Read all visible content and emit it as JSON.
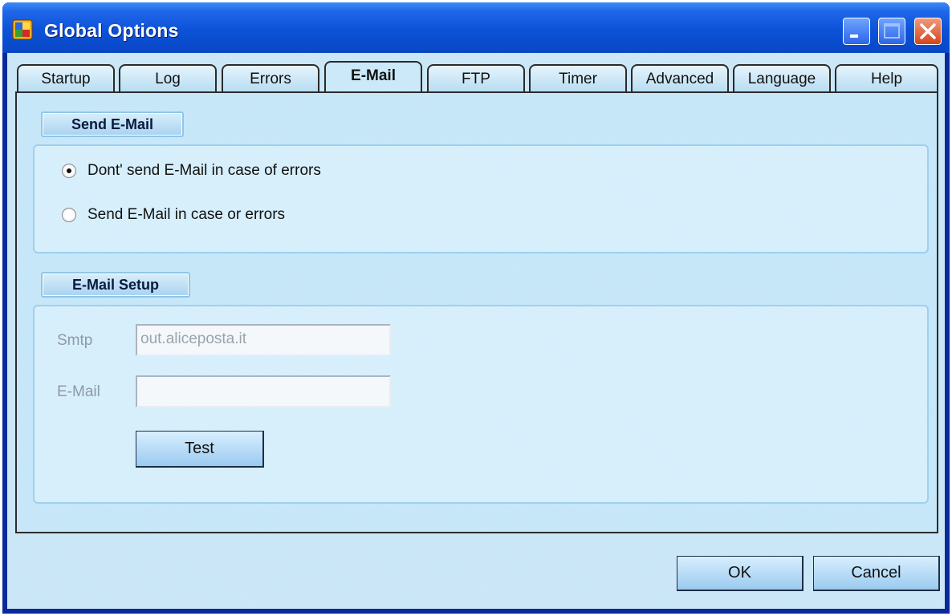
{
  "window": {
    "title": "Global Options"
  },
  "tabs": [
    {
      "label": "Startup"
    },
    {
      "label": "Log"
    },
    {
      "label": "Errors"
    },
    {
      "label": "E-Mail",
      "active": true
    },
    {
      "label": "FTP"
    },
    {
      "label": "Timer"
    },
    {
      "label": "Advanced"
    },
    {
      "label": "Language"
    },
    {
      "label": "Help"
    }
  ],
  "send_email": {
    "group_label": "Send E-Mail",
    "options": [
      {
        "label": "Dont' send E-Mail in case of errors",
        "selected": true
      },
      {
        "label": "Send E-Mail in case or errors",
        "selected": false
      }
    ]
  },
  "email_setup": {
    "group_label": "E-Mail Setup",
    "smtp_label": "Smtp",
    "smtp_value": "out.aliceposta.it",
    "email_label": "E-Mail",
    "email_value": "",
    "test_label": "Test"
  },
  "footer": {
    "ok_label": "OK",
    "cancel_label": "Cancel"
  }
}
